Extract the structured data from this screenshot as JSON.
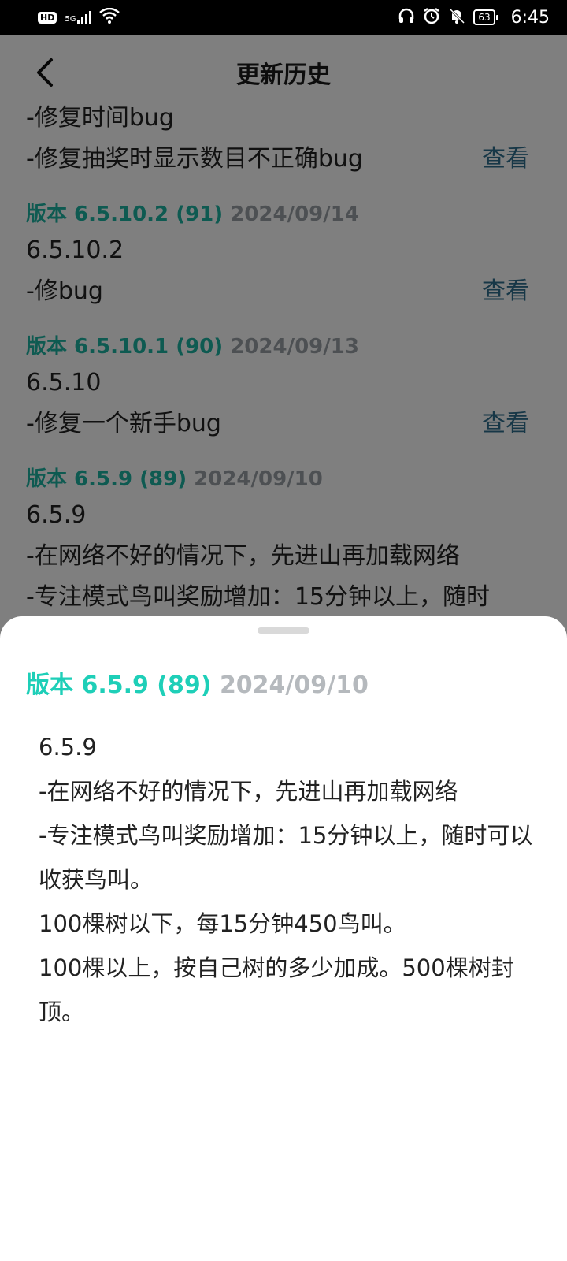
{
  "status_bar": {
    "hd": "HD",
    "network": "5G",
    "battery": "63",
    "time": "6:45"
  },
  "header": {
    "title": "更新历史"
  },
  "entries": [
    {
      "lines": [
        "-修复时间bug",
        "-修复抽奖时显示数目不正确bug"
      ],
      "view_label": "查看"
    },
    {
      "version": "版本 6.5.10.2 (91)",
      "date": "2024/09/14",
      "lines": [
        "6.5.10.2",
        "-修bug"
      ],
      "view_label": "查看"
    },
    {
      "version": "版本 6.5.10.1 (90)",
      "date": "2024/09/13",
      "lines": [
        "6.5.10",
        "-修复一个新手bug"
      ],
      "view_label": "查看"
    },
    {
      "version": "版本 6.5.9 (89)",
      "date": "2024/09/10",
      "lines": [
        "6.5.9",
        "-在网络不好的情况下，先进山再加载网络",
        "-专注模式鸟叫奖励增加：15分钟以上，随时"
      ]
    }
  ],
  "sheet": {
    "version": "版本 6.5.9 (89)",
    "date": "2024/09/10",
    "lines": [
      "6.5.9",
      "-在网络不好的情况下，先进山再加载网络",
      "-专注模式鸟叫奖励增加：15分钟以上，随时可以收获鸟叫。",
      "100棵树以下，每15分钟450鸟叫。",
      "100棵以上，按自己树的多少加成。500棵树封顶。"
    ]
  },
  "colors": {
    "accent": "#1ecfb8",
    "date_gray": "#b5b9bd",
    "link": "#2f6f8f"
  }
}
